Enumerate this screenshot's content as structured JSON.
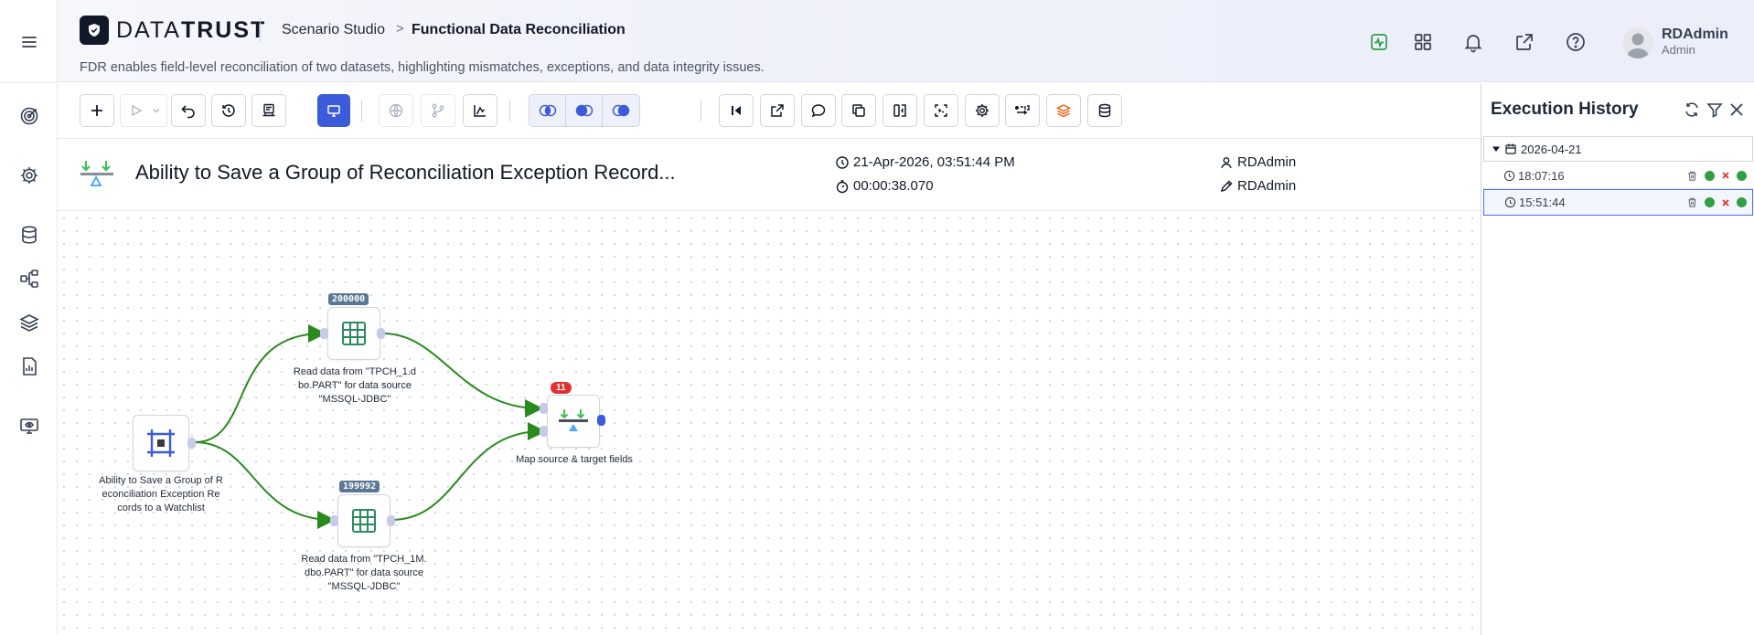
{
  "header": {
    "brand_plain": "DATA",
    "brand_bold": "TRUST",
    "breadcrumb_parent": "Scenario Studio",
    "breadcrumb_separator": ">",
    "breadcrumb_current": "Functional Data Reconciliation",
    "subtitle": "FDR enables field-level reconciliation of two datasets, highlighting mismatches, exceptions, and data integrity issues.",
    "user_name": "RDAdmin",
    "user_role": "Admin",
    "icons": [
      "activity-icon",
      "apps-grid-icon",
      "bell-icon",
      "external-link-icon",
      "help-icon"
    ]
  },
  "rail": {
    "icons": [
      "menu-icon",
      "target-icon",
      "settings-icon",
      "database-icon",
      "workflow-icon",
      "layers-icon",
      "report-icon",
      "monitor-eye-icon"
    ]
  },
  "info": {
    "title": "Ability to Save a Group of Reconciliation Exception Record...",
    "datetime": "21-Apr-2026, 03:51:44 PM",
    "duration": "00:00:38.070",
    "created_by": "RDAdmin",
    "modified_by": "RDAdmin"
  },
  "canvas": {
    "nodes": [
      {
        "id": "start",
        "label_lines": [
          "Ability to Save a Group of R",
          "econciliation Exception Re",
          "cords to a Watchlist"
        ]
      },
      {
        "id": "read1",
        "count": "200000",
        "label_lines": [
          "Read data from \"TPCH_1.d",
          "bo.PART\" for data source",
          "\"MSSQL-JDBC\""
        ]
      },
      {
        "id": "read2",
        "count": "199992",
        "label_lines": [
          "Read data from \"TPCH_1M.",
          "dbo.PART\" for data source",
          "\"MSSQL-JDBC\""
        ]
      },
      {
        "id": "map",
        "count": "11",
        "label_lines": [
          "Map source & target fields"
        ]
      }
    ]
  },
  "history": {
    "title": "Execution History",
    "date": "2026-04-21",
    "runs": [
      {
        "time": "18:07:16",
        "selected": false
      },
      {
        "time": "15:51:44",
        "selected": true
      }
    ]
  },
  "colors": {
    "accent": "#3b5bdb",
    "edge": "#2b8a1e",
    "success": "#2f9e44",
    "error": "#e03131"
  }
}
